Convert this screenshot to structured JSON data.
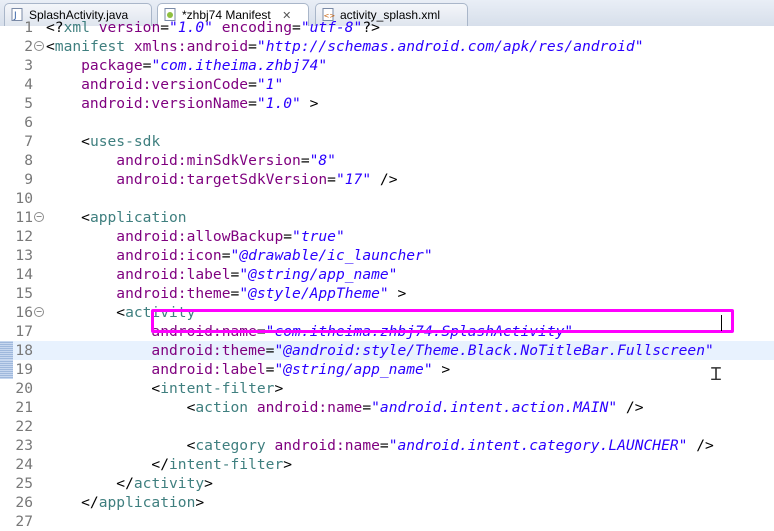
{
  "tabs": [
    {
      "label": "SplashActivity.java",
      "icon": "java-file-icon",
      "active": false
    },
    {
      "label": "*zhbj74 Manifest",
      "icon": "manifest-file-icon",
      "active": true,
      "close": "✕"
    },
    {
      "label": "activity_splash.xml",
      "icon": "xml-file-icon",
      "active": false
    }
  ],
  "lines": [
    {
      "n": "1",
      "t": [
        [
          "punct",
          "<?"
        ],
        [
          "tag",
          "xml"
        ],
        [
          "attr",
          " version"
        ],
        [
          "punct",
          "="
        ],
        [
          "val",
          "\"1.0\""
        ],
        [
          "attr",
          " encoding"
        ],
        [
          "punct",
          "="
        ],
        [
          "val",
          "\"utf-8\""
        ],
        [
          "punct",
          "?>"
        ]
      ]
    },
    {
      "n": "2",
      "t": [
        [
          "punct",
          "<"
        ],
        [
          "tag",
          "manifest"
        ],
        [
          "attr",
          " xmlns:android"
        ],
        [
          "punct",
          "="
        ],
        [
          "val",
          "\"http://schemas.android.com/apk/res/android\""
        ]
      ]
    },
    {
      "n": "3",
      "t": [
        [
          "attr",
          "    package"
        ],
        [
          "punct",
          "="
        ],
        [
          "val",
          "\"com.itheima.zhbj74\""
        ]
      ]
    },
    {
      "n": "4",
      "t": [
        [
          "attr",
          "    android:versionCode"
        ],
        [
          "punct",
          "="
        ],
        [
          "val",
          "\"1\""
        ]
      ]
    },
    {
      "n": "5",
      "t": [
        [
          "attr",
          "    android:versionName"
        ],
        [
          "punct",
          "="
        ],
        [
          "val",
          "\"1.0\""
        ],
        [
          "punct",
          " >"
        ]
      ]
    },
    {
      "n": "6",
      "t": []
    },
    {
      "n": "7",
      "t": [
        [
          "punct",
          "    <"
        ],
        [
          "tag",
          "uses-sdk"
        ]
      ]
    },
    {
      "n": "8",
      "t": [
        [
          "attr",
          "        android:minSdkVersion"
        ],
        [
          "punct",
          "="
        ],
        [
          "val",
          "\"8\""
        ]
      ]
    },
    {
      "n": "9",
      "t": [
        [
          "attr",
          "        android:targetSdkVersion"
        ],
        [
          "punct",
          "="
        ],
        [
          "val",
          "\"17\""
        ],
        [
          "punct",
          " />"
        ]
      ]
    },
    {
      "n": "10",
      "t": []
    },
    {
      "n": "11",
      "t": [
        [
          "punct",
          "    <"
        ],
        [
          "tag",
          "application"
        ]
      ]
    },
    {
      "n": "12",
      "t": [
        [
          "attr",
          "        android:allowBackup"
        ],
        [
          "punct",
          "="
        ],
        [
          "val",
          "\"true\""
        ]
      ]
    },
    {
      "n": "13",
      "t": [
        [
          "attr",
          "        android:icon"
        ],
        [
          "punct",
          "="
        ],
        [
          "val",
          "\"@drawable/ic_launcher\""
        ]
      ]
    },
    {
      "n": "14",
      "t": [
        [
          "attr",
          "        android:label"
        ],
        [
          "punct",
          "="
        ],
        [
          "val",
          "\"@string/app_name\""
        ]
      ]
    },
    {
      "n": "15",
      "t": [
        [
          "attr",
          "        android:theme"
        ],
        [
          "punct",
          "="
        ],
        [
          "val",
          "\"@style/AppTheme\""
        ],
        [
          "punct",
          " >"
        ]
      ]
    },
    {
      "n": "16",
      "t": [
        [
          "punct",
          "        <"
        ],
        [
          "tag",
          "activity"
        ]
      ]
    },
    {
      "n": "17",
      "t": [
        [
          "attr",
          "            android:name"
        ],
        [
          "punct",
          "="
        ],
        [
          "val",
          "\"com.itheima.zhbj74.SplashActivity\""
        ]
      ]
    },
    {
      "n": "18",
      "t": [
        [
          "attr",
          "            android:theme"
        ],
        [
          "punct",
          "="
        ],
        [
          "val",
          "\"@android:style/Theme.Black.NoTitleBar.Fullscreen\""
        ]
      ]
    },
    {
      "n": "19",
      "t": [
        [
          "attr",
          "            android:label"
        ],
        [
          "punct",
          "="
        ],
        [
          "val",
          "\"@string/app_name\""
        ],
        [
          "punct",
          " >"
        ]
      ]
    },
    {
      "n": "20",
      "t": [
        [
          "punct",
          "            <"
        ],
        [
          "tag",
          "intent-filter"
        ],
        [
          "punct",
          ">"
        ]
      ]
    },
    {
      "n": "21",
      "t": [
        [
          "punct",
          "                <"
        ],
        [
          "tag",
          "action"
        ],
        [
          "attr",
          " android:name"
        ],
        [
          "punct",
          "="
        ],
        [
          "val",
          "\"android.intent.action.MAIN\""
        ],
        [
          "punct",
          " />"
        ]
      ]
    },
    {
      "n": "22",
      "t": []
    },
    {
      "n": "23",
      "t": [
        [
          "punct",
          "                <"
        ],
        [
          "tag",
          "category"
        ],
        [
          "attr",
          " android:name"
        ],
        [
          "punct",
          "="
        ],
        [
          "val",
          "\"android.intent.category.LAUNCHER\""
        ],
        [
          "punct",
          " />"
        ]
      ]
    },
    {
      "n": "24",
      "t": [
        [
          "punct",
          "            </"
        ],
        [
          "tag",
          "intent-filter"
        ],
        [
          "punct",
          ">"
        ]
      ]
    },
    {
      "n": "25",
      "t": [
        [
          "punct",
          "        </"
        ],
        [
          "tag",
          "activity"
        ],
        [
          "punct",
          ">"
        ]
      ]
    },
    {
      "n": "26",
      "t": [
        [
          "punct",
          "    </"
        ],
        [
          "tag",
          "application"
        ],
        [
          "punct",
          ">"
        ]
      ]
    },
    {
      "n": "27",
      "t": []
    }
  ],
  "fold_markers": [
    "2",
    "11",
    "16"
  ],
  "current_line": "18",
  "highlight_color": "#ff00ff"
}
